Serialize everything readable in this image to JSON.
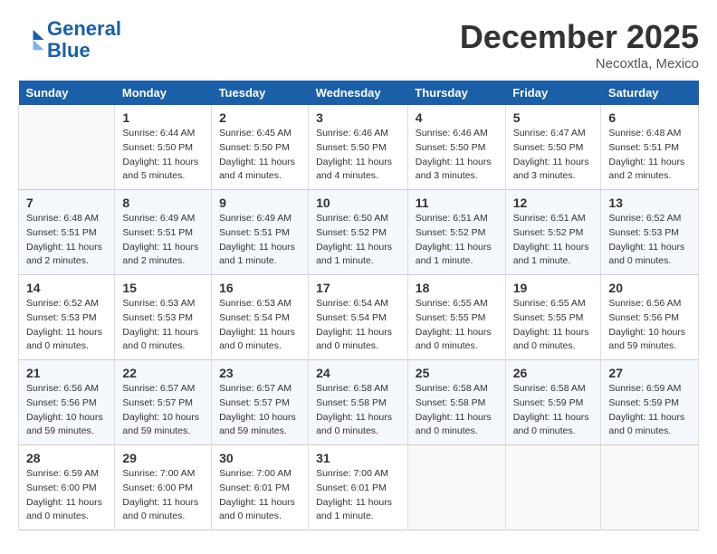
{
  "logo": {
    "line1": "General",
    "line2": "Blue"
  },
  "title": "December 2025",
  "location": "Necoxtla, Mexico",
  "days_of_week": [
    "Sunday",
    "Monday",
    "Tuesday",
    "Wednesday",
    "Thursday",
    "Friday",
    "Saturday"
  ],
  "weeks": [
    [
      {
        "num": "",
        "sunrise": "",
        "sunset": "",
        "daylight": "",
        "empty": true
      },
      {
        "num": "1",
        "sunrise": "Sunrise: 6:44 AM",
        "sunset": "Sunset: 5:50 PM",
        "daylight": "Daylight: 11 hours and 5 minutes."
      },
      {
        "num": "2",
        "sunrise": "Sunrise: 6:45 AM",
        "sunset": "Sunset: 5:50 PM",
        "daylight": "Daylight: 11 hours and 4 minutes."
      },
      {
        "num": "3",
        "sunrise": "Sunrise: 6:46 AM",
        "sunset": "Sunset: 5:50 PM",
        "daylight": "Daylight: 11 hours and 4 minutes."
      },
      {
        "num": "4",
        "sunrise": "Sunrise: 6:46 AM",
        "sunset": "Sunset: 5:50 PM",
        "daylight": "Daylight: 11 hours and 3 minutes."
      },
      {
        "num": "5",
        "sunrise": "Sunrise: 6:47 AM",
        "sunset": "Sunset: 5:50 PM",
        "daylight": "Daylight: 11 hours and 3 minutes."
      },
      {
        "num": "6",
        "sunrise": "Sunrise: 6:48 AM",
        "sunset": "Sunset: 5:51 PM",
        "daylight": "Daylight: 11 hours and 2 minutes."
      }
    ],
    [
      {
        "num": "7",
        "sunrise": "Sunrise: 6:48 AM",
        "sunset": "Sunset: 5:51 PM",
        "daylight": "Daylight: 11 hours and 2 minutes."
      },
      {
        "num": "8",
        "sunrise": "Sunrise: 6:49 AM",
        "sunset": "Sunset: 5:51 PM",
        "daylight": "Daylight: 11 hours and 2 minutes."
      },
      {
        "num": "9",
        "sunrise": "Sunrise: 6:49 AM",
        "sunset": "Sunset: 5:51 PM",
        "daylight": "Daylight: 11 hours and 1 minute."
      },
      {
        "num": "10",
        "sunrise": "Sunrise: 6:50 AM",
        "sunset": "Sunset: 5:52 PM",
        "daylight": "Daylight: 11 hours and 1 minute."
      },
      {
        "num": "11",
        "sunrise": "Sunrise: 6:51 AM",
        "sunset": "Sunset: 5:52 PM",
        "daylight": "Daylight: 11 hours and 1 minute."
      },
      {
        "num": "12",
        "sunrise": "Sunrise: 6:51 AM",
        "sunset": "Sunset: 5:52 PM",
        "daylight": "Daylight: 11 hours and 1 minute."
      },
      {
        "num": "13",
        "sunrise": "Sunrise: 6:52 AM",
        "sunset": "Sunset: 5:53 PM",
        "daylight": "Daylight: 11 hours and 0 minutes."
      }
    ],
    [
      {
        "num": "14",
        "sunrise": "Sunrise: 6:52 AM",
        "sunset": "Sunset: 5:53 PM",
        "daylight": "Daylight: 11 hours and 0 minutes."
      },
      {
        "num": "15",
        "sunrise": "Sunrise: 6:53 AM",
        "sunset": "Sunset: 5:53 PM",
        "daylight": "Daylight: 11 hours and 0 minutes."
      },
      {
        "num": "16",
        "sunrise": "Sunrise: 6:53 AM",
        "sunset": "Sunset: 5:54 PM",
        "daylight": "Daylight: 11 hours and 0 minutes."
      },
      {
        "num": "17",
        "sunrise": "Sunrise: 6:54 AM",
        "sunset": "Sunset: 5:54 PM",
        "daylight": "Daylight: 11 hours and 0 minutes."
      },
      {
        "num": "18",
        "sunrise": "Sunrise: 6:55 AM",
        "sunset": "Sunset: 5:55 PM",
        "daylight": "Daylight: 11 hours and 0 minutes."
      },
      {
        "num": "19",
        "sunrise": "Sunrise: 6:55 AM",
        "sunset": "Sunset: 5:55 PM",
        "daylight": "Daylight: 11 hours and 0 minutes."
      },
      {
        "num": "20",
        "sunrise": "Sunrise: 6:56 AM",
        "sunset": "Sunset: 5:56 PM",
        "daylight": "Daylight: 10 hours and 59 minutes."
      }
    ],
    [
      {
        "num": "21",
        "sunrise": "Sunrise: 6:56 AM",
        "sunset": "Sunset: 5:56 PM",
        "daylight": "Daylight: 10 hours and 59 minutes."
      },
      {
        "num": "22",
        "sunrise": "Sunrise: 6:57 AM",
        "sunset": "Sunset: 5:57 PM",
        "daylight": "Daylight: 10 hours and 59 minutes."
      },
      {
        "num": "23",
        "sunrise": "Sunrise: 6:57 AM",
        "sunset": "Sunset: 5:57 PM",
        "daylight": "Daylight: 10 hours and 59 minutes."
      },
      {
        "num": "24",
        "sunrise": "Sunrise: 6:58 AM",
        "sunset": "Sunset: 5:58 PM",
        "daylight": "Daylight: 11 hours and 0 minutes."
      },
      {
        "num": "25",
        "sunrise": "Sunrise: 6:58 AM",
        "sunset": "Sunset: 5:58 PM",
        "daylight": "Daylight: 11 hours and 0 minutes."
      },
      {
        "num": "26",
        "sunrise": "Sunrise: 6:58 AM",
        "sunset": "Sunset: 5:59 PM",
        "daylight": "Daylight: 11 hours and 0 minutes."
      },
      {
        "num": "27",
        "sunrise": "Sunrise: 6:59 AM",
        "sunset": "Sunset: 5:59 PM",
        "daylight": "Daylight: 11 hours and 0 minutes."
      }
    ],
    [
      {
        "num": "28",
        "sunrise": "Sunrise: 6:59 AM",
        "sunset": "Sunset: 6:00 PM",
        "daylight": "Daylight: 11 hours and 0 minutes."
      },
      {
        "num": "29",
        "sunrise": "Sunrise: 7:00 AM",
        "sunset": "Sunset: 6:00 PM",
        "daylight": "Daylight: 11 hours and 0 minutes."
      },
      {
        "num": "30",
        "sunrise": "Sunrise: 7:00 AM",
        "sunset": "Sunset: 6:01 PM",
        "daylight": "Daylight: 11 hours and 0 minutes."
      },
      {
        "num": "31",
        "sunrise": "Sunrise: 7:00 AM",
        "sunset": "Sunset: 6:01 PM",
        "daylight": "Daylight: 11 hours and 1 minute."
      },
      {
        "num": "",
        "empty": true
      },
      {
        "num": "",
        "empty": true
      },
      {
        "num": "",
        "empty": true
      }
    ]
  ]
}
